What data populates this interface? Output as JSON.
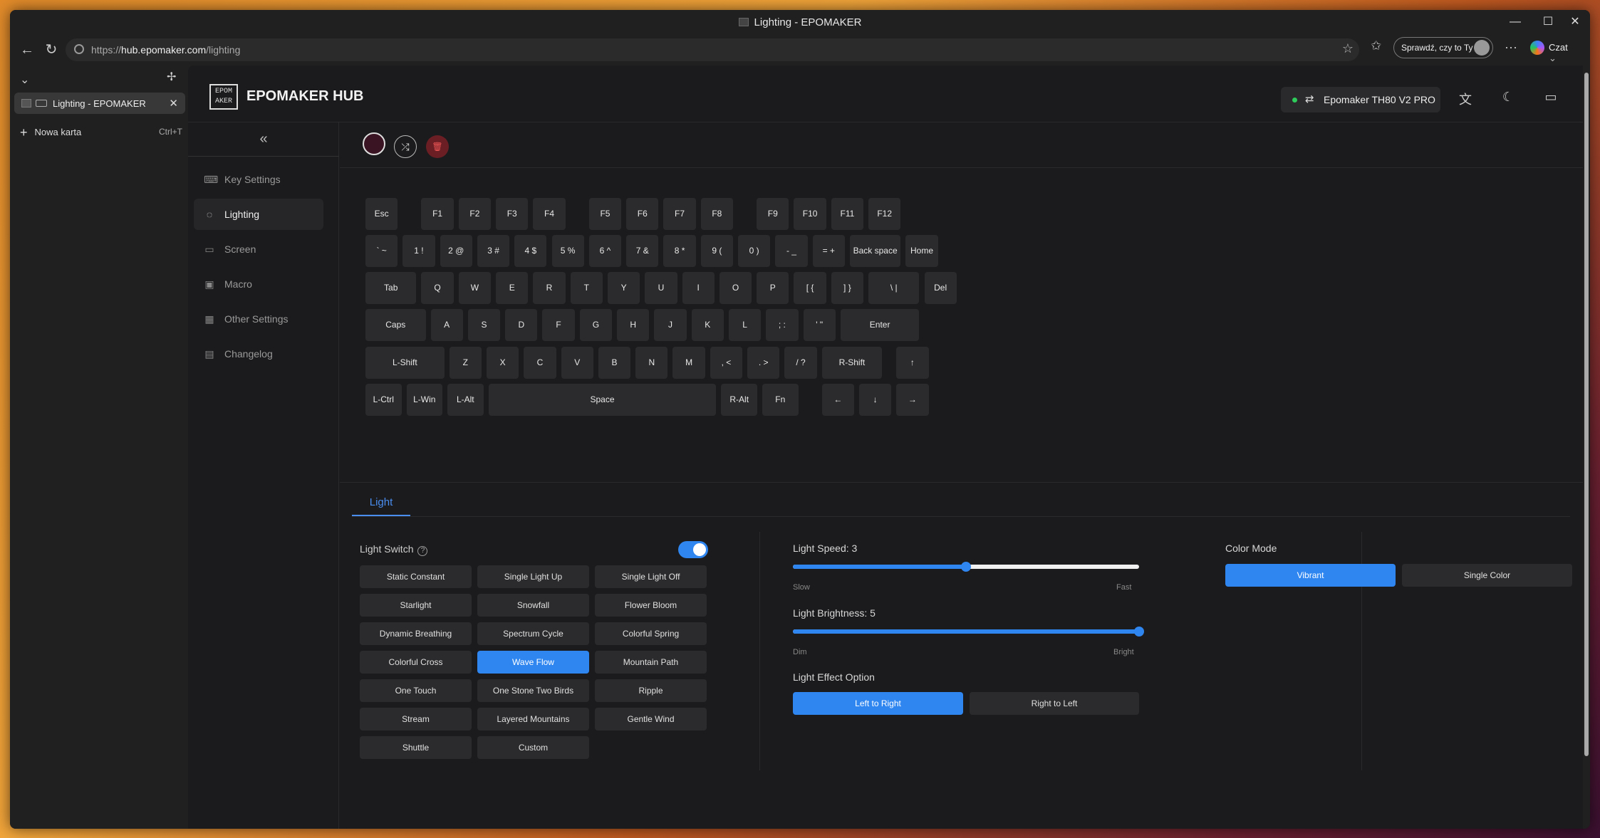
{
  "browser": {
    "window_title": "Lighting - EPOMAKER",
    "url_prefix": "https://",
    "url_host": "hub.epomaker.com",
    "url_path": "/lighting",
    "profile_label": "Sprawdź, czy to Ty",
    "copilot_label": "Czat",
    "tab_title": "Lighting - EPOMAKER",
    "new_tab_label": "Nowa karta",
    "new_tab_shortcut": "Ctrl+T"
  },
  "app": {
    "brand": "EPOMAKER HUB",
    "logo_text": "EPOM AKER",
    "device_name": "Epomaker TH80 V2 PRO",
    "device_status_color": "#2ecc5a"
  },
  "nav": {
    "items": [
      {
        "label": "Key Settings",
        "icon": "keyboard-icon"
      },
      {
        "label": "Lighting",
        "icon": "lightbulb-icon"
      },
      {
        "label": "Screen",
        "icon": "monitor-icon"
      },
      {
        "label": "Macro",
        "icon": "image-icon"
      },
      {
        "label": "Other Settings",
        "icon": "grid-icon"
      },
      {
        "label": "Changelog",
        "icon": "document-icon"
      }
    ],
    "active": "Lighting"
  },
  "keyboard": {
    "rows": [
      [
        "Esc",
        "F1",
        "F2",
        "F3",
        "F4",
        "F5",
        "F6",
        "F7",
        "F8",
        "F9",
        "F10",
        "F11",
        "F12"
      ],
      [
        "` ~",
        "1 !",
        "2 @",
        "3 #",
        "4 $",
        "5 %",
        "6 ^",
        "7 &",
        "8 *",
        "9 (",
        "0 )",
        "- _",
        "= +",
        "Back space",
        "Home"
      ],
      [
        "Tab",
        "Q",
        "W",
        "E",
        "R",
        "T",
        "Y",
        "U",
        "I",
        "O",
        "P",
        "[ {",
        "] }",
        "\\ |",
        "Del"
      ],
      [
        "Caps",
        "A",
        "S",
        "D",
        "F",
        "G",
        "H",
        "J",
        "K",
        "L",
        "; :",
        "' \"",
        "Enter"
      ],
      [
        "L-Shift",
        "Z",
        "X",
        "C",
        "V",
        "B",
        "N",
        "M",
        ", <",
        ". >",
        "/ ?",
        "R-Shift",
        "↑"
      ],
      [
        "L-Ctrl",
        "L-Win",
        "L-Alt",
        "Space",
        "R-Alt",
        "Fn",
        "←",
        "↓",
        "→"
      ]
    ]
  },
  "lighting": {
    "tab_label": "Light",
    "switch_label": "Light Switch",
    "switch_on": true,
    "effects": [
      "Static Constant",
      "Single Light Up",
      "Single Light Off",
      "Starlight",
      "Snowfall",
      "Flower Bloom",
      "Dynamic Breathing",
      "Spectrum Cycle",
      "Colorful Spring",
      "Colorful Cross",
      "Wave Flow",
      "Mountain Path",
      "One Touch",
      "One Stone Two Birds",
      "Ripple",
      "Stream",
      "Layered Mountains",
      "Gentle Wind",
      "Shuttle",
      "Custom"
    ],
    "active_effect": "Wave Flow",
    "speed_label": "Light Speed: 3",
    "speed_value": 3,
    "speed_max": 6,
    "speed_min_label": "Slow",
    "speed_max_label": "Fast",
    "brightness_label": "Light Brightness: 5",
    "brightness_value": 5,
    "brightness_max": 5,
    "brightness_min_label": "Dim",
    "brightness_max_label": "Bright",
    "effect_option_label": "Light Effect Option",
    "options": [
      "Left to Right",
      "Right to Left"
    ],
    "active_option": "Left to Right",
    "color_mode_label": "Color Mode",
    "color_modes": [
      "Vibrant",
      "Single Color"
    ],
    "active_color_mode": "Vibrant",
    "current_color": "#3a1422",
    "accent": "#2f86f0"
  }
}
